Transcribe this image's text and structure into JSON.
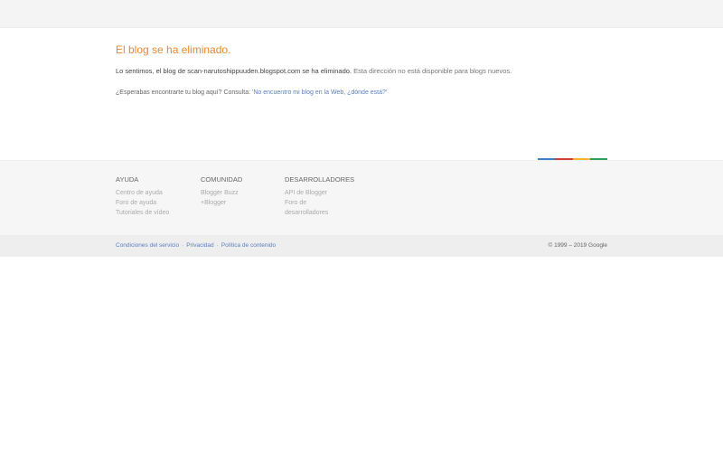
{
  "main": {
    "title": "El blog se ha eliminado.",
    "message_main": "Lo sentimos, el blog de scan-narutoshippuuden.blogspot.com se ha eliminado.",
    "message_secondary": "Esta dirección no está disponible para blogs nuevos.",
    "hint_prefix": "¿Esperabas encontrarte tu blog aquí? Consulta:",
    "hint_link": "'No encuentro mi blog en la Web, ¿dónde está?'"
  },
  "colors": {
    "accent": "#e8892f",
    "link": "#5a7fbf",
    "bar": [
      "#3b82c4",
      "#d43b3b",
      "#f2b630",
      "#2da35a"
    ]
  },
  "footer": {
    "columns": [
      {
        "heading": "Ayuda",
        "links": [
          "Centro de ayuda",
          "Foro de ayuda",
          "Tutoriales de vídeo"
        ]
      },
      {
        "heading": "Comunidad",
        "links": [
          "Blogger Buzz",
          "+Blogger"
        ]
      },
      {
        "heading": "Desarrolladores",
        "links": [
          "API de Blogger",
          "Foro de",
          "desarrolladores"
        ]
      }
    ]
  },
  "bottom": {
    "links": [
      "Condiciones del servicio",
      "Privacidad",
      "Política de contenido"
    ],
    "copyright": "© 1999 – 2019 Google"
  }
}
